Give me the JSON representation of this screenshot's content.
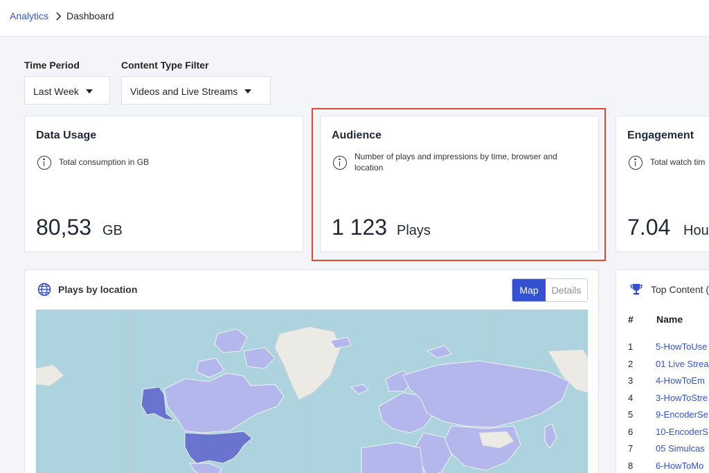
{
  "breadcrumb": {
    "root": "Analytics",
    "current": "Dashboard"
  },
  "filters": {
    "time_period": {
      "label": "Time Period",
      "value": "Last Week"
    },
    "content_type": {
      "label": "Content Type Filter",
      "value": "Videos and Live Streams"
    }
  },
  "cards": {
    "data_usage": {
      "title": "Data Usage",
      "description": "Total consumption in GB",
      "value": "80,53",
      "unit": "GB"
    },
    "audience": {
      "title": "Audience",
      "description_line1": "Number of plays and impressions by time, browser and",
      "description_line2": "location",
      "value": "1 123",
      "unit": "Plays"
    },
    "engagement": {
      "title": "Engagement",
      "description": "Total watch tim",
      "value": "7.04",
      "unit": "Hou"
    }
  },
  "plays_by_location": {
    "title": "Plays by location",
    "tabs": {
      "map": "Map",
      "details": "Details"
    }
  },
  "top_content": {
    "title": "Top Content (",
    "col_rank": "#",
    "col_name": "Name",
    "rows": [
      {
        "rank": "1",
        "name": "5-HowToUse"
      },
      {
        "rank": "2",
        "name": "01 Live Strea"
      },
      {
        "rank": "3",
        "name": "4-HowToEm"
      },
      {
        "rank": "4",
        "name": "3-HowToStre"
      },
      {
        "rank": "5",
        "name": "9-EncoderSe"
      },
      {
        "rank": "6",
        "name": "10-EncoderS"
      },
      {
        "rank": "7",
        "name": "05 Simulcas"
      },
      {
        "rank": "8",
        "name": "6-HowToMo"
      }
    ]
  },
  "colors": {
    "accent": "#3451d1",
    "highlight": "#e34530",
    "map_water": "#add4de",
    "map_land": "#eceae4",
    "map_light": "#b3b7ec",
    "map_dark": "#6a74cf"
  }
}
